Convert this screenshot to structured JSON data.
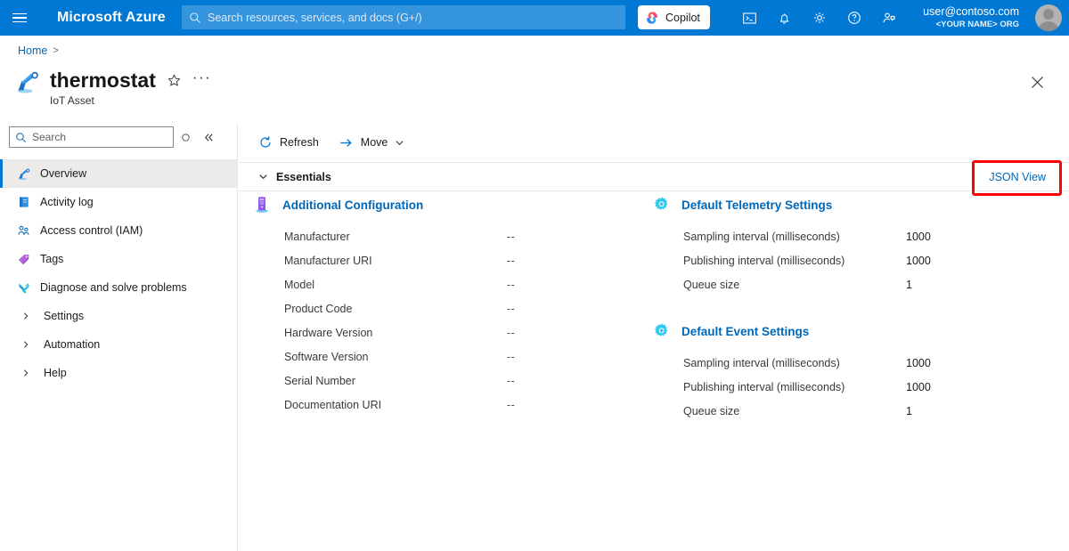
{
  "header": {
    "menu_icon": "hamburger-icon",
    "brand": "Microsoft Azure",
    "search_placeholder": "Search resources, services, and docs (G+/)",
    "search_value": "",
    "search_icon": "search-icon",
    "copilot_label": "Copilot",
    "icons": [
      {
        "name": "cloud-shell-icon"
      },
      {
        "name": "notifications-bell-icon"
      },
      {
        "name": "settings-gear-icon"
      },
      {
        "name": "help-question-icon"
      },
      {
        "name": "feedback-person-icon"
      }
    ],
    "account_email": "user@contoso.com",
    "account_org": "<YOUR NAME> ORG"
  },
  "breadcrumb": {
    "home": "Home",
    "separator": ">"
  },
  "title": {
    "resource_icon": "iot-asset-icon",
    "name": "thermostat",
    "subtitle": "IoT Asset",
    "favorite_icon": "star-icon",
    "more_icon": "ellipsis-icon",
    "close_icon": "close-icon"
  },
  "sidebar": {
    "search_placeholder": "Search",
    "search_value": "",
    "search_icon": "search-icon",
    "pin_icon": "pin-circle-icon",
    "collapse_icon": "double-chevron-left-icon",
    "items": [
      {
        "label": "Overview",
        "icon": "iot-asset-icon",
        "selected": true
      },
      {
        "label": "Activity log",
        "icon": "activity-log-icon",
        "selected": false
      },
      {
        "label": "Access control (IAM)",
        "icon": "access-control-icon",
        "selected": false
      },
      {
        "label": "Tags",
        "icon": "tag-icon",
        "selected": false
      },
      {
        "label": "Diagnose and solve problems",
        "icon": "diagnose-tools-icon",
        "selected": false
      }
    ],
    "groups": [
      {
        "label": "Settings",
        "icon": "chevron-right-icon"
      },
      {
        "label": "Automation",
        "icon": "chevron-right-icon"
      },
      {
        "label": "Help",
        "icon": "chevron-right-icon"
      }
    ]
  },
  "command_bar": {
    "refresh_label": "Refresh",
    "refresh_icon": "refresh-icon",
    "move_label": "Move",
    "move_icon": "arrow-right-icon",
    "move_chevron_icon": "chevron-down-icon"
  },
  "essentials": {
    "label": "Essentials",
    "chevron_icon": "chevron-down-icon",
    "json_view_label": "JSON View",
    "highlight_color": "#ff0000"
  },
  "sections": {
    "additional_configuration": {
      "title": "Additional Configuration",
      "icon": "device-config-icon",
      "rows": [
        {
          "key": "Manufacturer",
          "value": "--"
        },
        {
          "key": "Manufacturer URI",
          "value": "--"
        },
        {
          "key": "Model",
          "value": "--"
        },
        {
          "key": "Product Code",
          "value": "--"
        },
        {
          "key": "Hardware Version",
          "value": "--"
        },
        {
          "key": "Software Version",
          "value": "--"
        },
        {
          "key": "Serial Number",
          "value": "--"
        },
        {
          "key": "Documentation URI",
          "value": "--"
        }
      ]
    },
    "default_telemetry_settings": {
      "title": "Default Telemetry Settings",
      "icon": "gear-settings-icon",
      "rows": [
        {
          "key": "Sampling interval (milliseconds)",
          "value": "1000"
        },
        {
          "key": "Publishing interval (milliseconds)",
          "value": "1000"
        },
        {
          "key": "Queue size",
          "value": "1"
        }
      ]
    },
    "default_event_settings": {
      "title": "Default Event Settings",
      "icon": "gear-settings-icon",
      "rows": [
        {
          "key": "Sampling interval (milliseconds)",
          "value": "1000"
        },
        {
          "key": "Publishing interval (milliseconds)",
          "value": "1000"
        },
        {
          "key": "Queue size",
          "value": "1"
        }
      ]
    }
  },
  "theme": {
    "azure_blue": "#0078d4",
    "link_blue": "#0067b8",
    "selected_bg": "#edebe9"
  }
}
